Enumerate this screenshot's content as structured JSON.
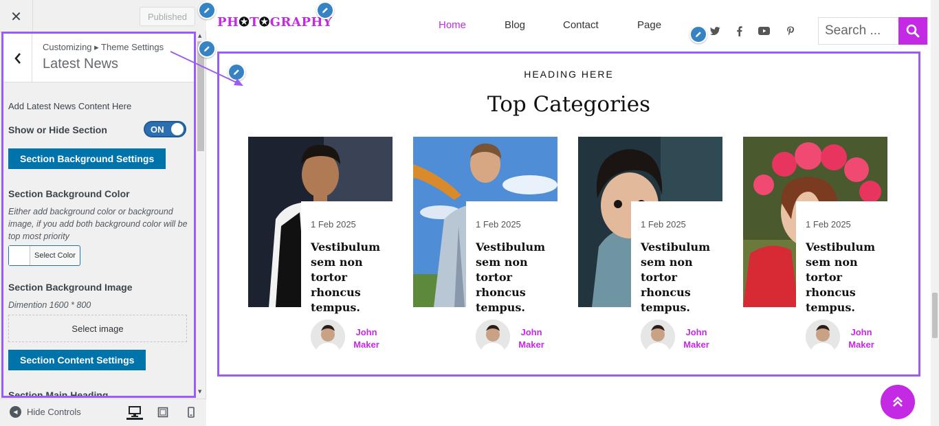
{
  "sidebar": {
    "close_icon": "close-icon",
    "published_label": "Published",
    "breadcrumb": "Customizing ▸ Theme Settings",
    "section_title": "Latest News",
    "desc": "Add Latest News Content Here",
    "show_hide_label": "Show or Hide Section",
    "toggle_label": "ON",
    "bg_settings_button": "Section Background Settings",
    "bg_color_title": "Section Background Color",
    "bg_color_note": "Either add background color or background image, if you add both background color will be top most priority",
    "select_color_label": "Select Color",
    "bg_image_title": "Section Background Image",
    "bg_image_note": "Dimention 1600 * 800",
    "select_image_label": "Select image",
    "content_settings_button": "Section Content Settings",
    "main_heading_title": "Section Main Heading",
    "hide_controls_label": "Hide Controls"
  },
  "site": {
    "logo": {
      "pre": "PH",
      "mid": "T",
      "post": "GRAPHY"
    },
    "nav": [
      {
        "label": "Home",
        "active": true
      },
      {
        "label": "Blog",
        "active": false
      },
      {
        "label": "Contact",
        "active": false
      },
      {
        "label": "Page",
        "active": false
      }
    ],
    "social_icons": [
      "twitter-icon",
      "facebook-icon",
      "youtube-icon",
      "pinterest-icon"
    ],
    "search_placeholder": "Search ...",
    "accent_color": "#c429e3",
    "section_small_heading": "HEADING HERE",
    "section_heading": "Top Categories",
    "cards": [
      {
        "date": "1 Feb 2025",
        "title": "Vestibulum sem non tortor rhoncus tempus.",
        "author_first": "John",
        "author_last": "Maker"
      },
      {
        "date": "1 Feb 2025",
        "title": "Vestibulum sem non tortor rhoncus tempus.",
        "author_first": "John",
        "author_last": "Maker"
      },
      {
        "date": "1 Feb 2025",
        "title": "Vestibulum sem non tortor rhoncus tempus.",
        "author_first": "John",
        "author_last": "Maker"
      },
      {
        "date": "1 Feb 2025",
        "title": "Vestibulum sem non tortor rhoncus tempus.",
        "author_first": "John",
        "author_last": "Maker"
      }
    ]
  }
}
